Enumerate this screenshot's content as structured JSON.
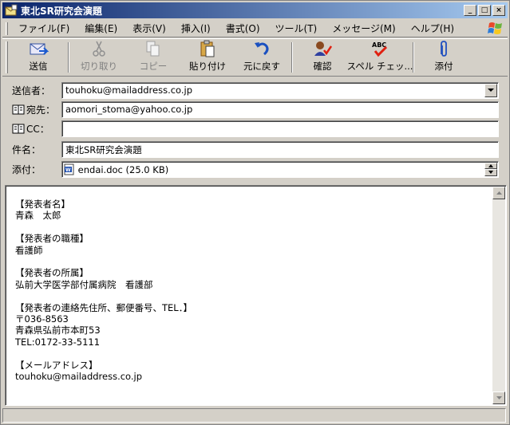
{
  "window": {
    "title": "東北SR研究会演題",
    "min_glyph": "_",
    "max_glyph": "□",
    "close_glyph": "×"
  },
  "menu": [
    "ファイル(F)",
    "編集(E)",
    "表示(V)",
    "挿入(I)",
    "書式(O)",
    "ツール(T)",
    "メッセージ(M)",
    "ヘルプ(H)"
  ],
  "toolbar": {
    "send": "送信",
    "cut": "切り取り",
    "copy": "コピー",
    "paste": "貼り付け",
    "undo": "元に戻す",
    "check": "確認",
    "spell": "スペル チェッ...",
    "attach": "添付"
  },
  "fields": {
    "from_label": "送信者：",
    "from_value": "touhoku@mailaddress.co.jp",
    "to_label": "宛先：",
    "to_value": "aomori_stoma@yahoo.co.jp",
    "cc_label": "CC：",
    "cc_value": "",
    "subject_label": "件名：",
    "subject_value": "東北SR研究会演題",
    "attach_label": "添付：",
    "attach_value": "endai.doc (25.0 KB)"
  },
  "message_body": "【発表者名】\n青森　太郎\n\n【発表者の職種】\n看護師\n\n【発表者の所属】\n弘前大学医学部付属病院　看護部\n\n【発表者の連絡先住所、郵便番号、TEL．】\n〒036-8563\n青森県弘前市本町53\nTEL:0172-33-5111\n\n【メールアドレス】\ntouhoku@mailaddress.co.jp",
  "colors": {
    "title_start": "#0a246a",
    "title_end": "#a6caf0",
    "face": "#d4d0c8"
  }
}
